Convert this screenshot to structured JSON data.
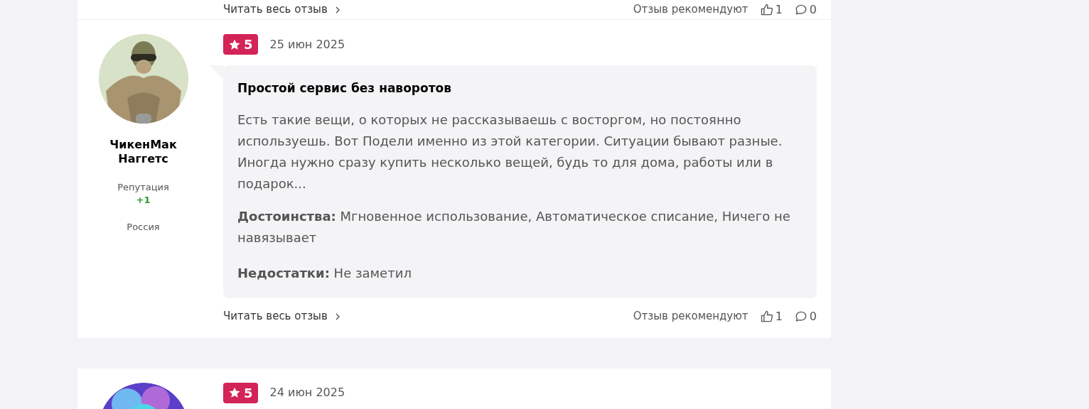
{
  "previous_review_footer": {
    "read_more": "Читать весь отзыв",
    "recommend_label": "Отзыв рекомендуют",
    "likes": "1",
    "comments": "0"
  },
  "reviews": [
    {
      "rating": "5",
      "date": "25 июн 2025",
      "author": "ЧикенМак Наггетс",
      "reputation_label": "Репутация",
      "reputation": "+1",
      "country": "Россия",
      "title": "Простой сервис без наворотов",
      "text": "Есть такие вещи, о которых не рассказываешь с восторгом, но постоянно используешь. Вот Подели именно из этой категории. Ситуации бывают разные. Иногда нужно сразу купить несколько вещей, будь то для дома, работы или в подарок...",
      "pros": "**Достоинства:** Мгновенное использование, Автоматическое списание, Ничего не навязывает",
      "cons": "**Недостатки:** Не заметил",
      "read_more": "Читать весь отзыв",
      "recommend_label": "Отзыв рекомендуют",
      "likes": "1",
      "comments": "0"
    },
    {
      "rating": "5",
      "date": "24 июн 2025"
    }
  ]
}
